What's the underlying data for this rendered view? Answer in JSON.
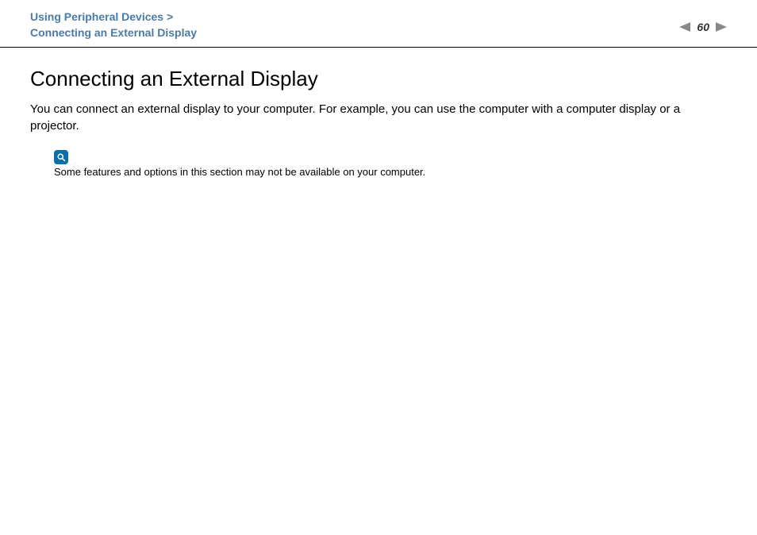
{
  "breadcrumb": {
    "line1": "Using Peripheral Devices >",
    "line2": "Connecting an External Display"
  },
  "nav": {
    "page_number": "60"
  },
  "content": {
    "title": "Connecting an External Display",
    "intro": "You can connect an external display to your computer. For example, you can use the computer with a computer display or a projector.",
    "note_text": "Some features and options in this section may not be available on your computer."
  }
}
